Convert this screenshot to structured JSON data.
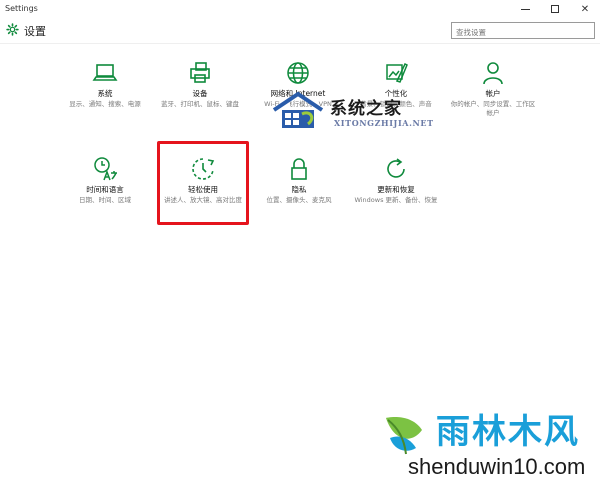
{
  "window": {
    "title": "Settings"
  },
  "header": {
    "heading": "设置"
  },
  "search": {
    "placeholder": "查找设置"
  },
  "tiles": [
    {
      "label": "系统",
      "desc": "显示、通知、搜索、电源",
      "icon": "laptop-icon"
    },
    {
      "label": "设备",
      "desc": "蓝牙、打印机、鼠标、键盘",
      "icon": "devices-icon"
    },
    {
      "label": "网络和 Internet",
      "desc": "Wi-Fi、飞行模式、VPN",
      "icon": "globe-icon"
    },
    {
      "label": "个性化",
      "desc": "背景、锁屏、颜色、声音",
      "icon": "personalization-icon"
    },
    {
      "label": "帐户",
      "desc": "你的帐户、同步设置、工作区帐户",
      "icon": "person-icon"
    },
    {
      "label": "时间和语言",
      "desc": "日期、时间、区域",
      "icon": "time-language-icon"
    },
    {
      "label": "轻松使用",
      "desc": "讲述人、放大镜、高对比度",
      "icon": "ease-of-access-icon"
    },
    {
      "label": "隐私",
      "desc": "位置、摄像头、麦克风",
      "icon": "lock-icon"
    },
    {
      "label": "更新和恢复",
      "desc": "Windows 更新、备份、恢复",
      "icon": "update-icon"
    }
  ],
  "watermarks": {
    "site1_name": "系统之家",
    "site1_sub": "XITONGZHIJIA.NET",
    "site2_name": "雨林木风",
    "site2_url": "shenduwin10.com"
  },
  "colors": {
    "accent": "#0f8a3c",
    "highlight": "#e5141d",
    "watermark_blue": "#1a9fd9"
  }
}
